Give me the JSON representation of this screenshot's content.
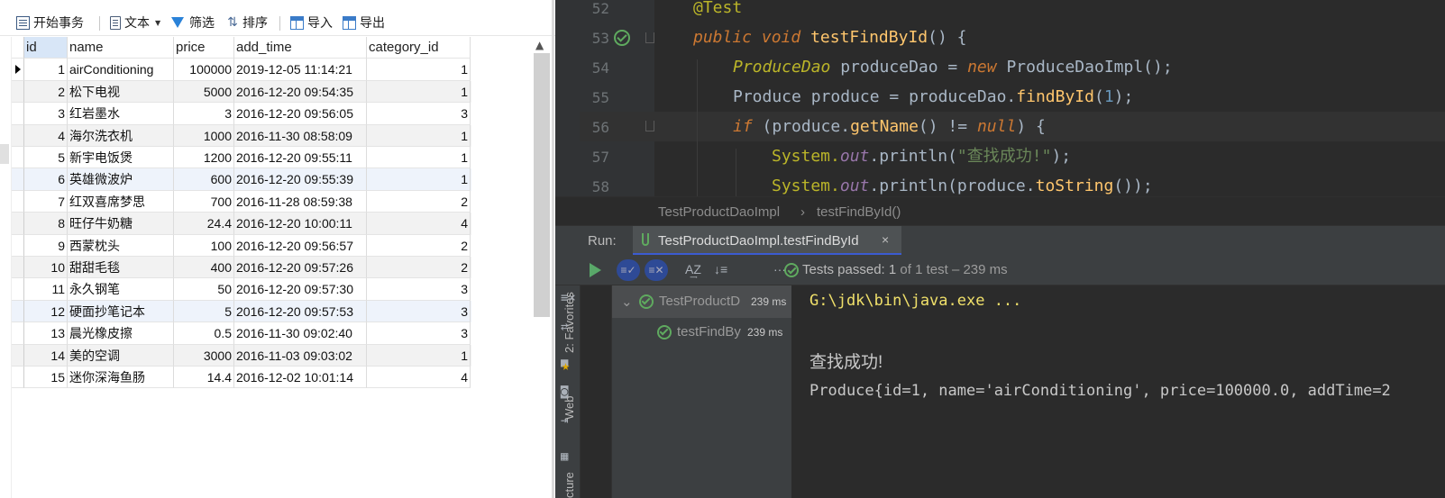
{
  "toolbar": {
    "begin_tx": "开始事务",
    "text": "文本",
    "filter": "筛选",
    "sort": "排序",
    "import": "导入",
    "export": "导出"
  },
  "table": {
    "columns": [
      "id",
      "name",
      "price",
      "add_time",
      "category_id"
    ],
    "rows": [
      [
        "1",
        "airConditioning",
        "100000",
        "2019-12-05 11:14:21",
        "1"
      ],
      [
        "2",
        "松下电视",
        "5000",
        "2016-12-20 09:54:35",
        "1"
      ],
      [
        "3",
        "红岩墨水",
        "3",
        "2016-12-20 09:56:05",
        "3"
      ],
      [
        "4",
        "海尔洗衣机",
        "1000",
        "2016-11-30 08:58:09",
        "1"
      ],
      [
        "5",
        "新宇电饭煲",
        "1200",
        "2016-12-20 09:55:11",
        "1"
      ],
      [
        "6",
        "英雄微波炉",
        "600",
        "2016-12-20 09:55:39",
        "1"
      ],
      [
        "7",
        "红双喜席梦思",
        "700",
        "2016-11-28 08:59:38",
        "2"
      ],
      [
        "8",
        "旺仔牛奶糖",
        "24.4",
        "2016-12-20 10:00:11",
        "4"
      ],
      [
        "9",
        "西蒙枕头",
        "100",
        "2016-12-20 09:56:57",
        "2"
      ],
      [
        "10",
        "甜甜毛毯",
        "400",
        "2016-12-20 09:57:26",
        "2"
      ],
      [
        "11",
        "永久钢笔",
        "50",
        "2016-12-20 09:57:30",
        "3"
      ],
      [
        "12",
        "硬面抄笔记本",
        "5",
        "2016-12-20 09:57:53",
        "3"
      ],
      [
        "13",
        "晨光橡皮擦",
        "0.5",
        "2016-11-30 09:02:40",
        "3"
      ],
      [
        "14",
        "美的空调",
        "3000",
        "2016-11-03 09:03:02",
        "1"
      ],
      [
        "15",
        "迷你深海鱼肠",
        "14.4",
        "2016-12-02 10:01:14",
        "4"
      ]
    ]
  },
  "editor": {
    "line_numbers": [
      "52",
      "53",
      "54",
      "55",
      "56",
      "57",
      "58"
    ],
    "code": {
      "l52": "@Test",
      "l53_k1": "public",
      "l53_k2": "void",
      "l53_fn": "testFindById",
      "l53_rest": "() {",
      "l54_ty": "ProduceDao",
      "l54_mid": " produceDao = ",
      "l54_new": "new",
      "l54_rest": " ProduceDaoImpl();",
      "l55_a": "Produce produce = produceDao.",
      "l55_fn": "findById",
      "l55_b": "(",
      "l55_num": "1",
      "l55_c": ");",
      "l56_if": "if",
      "l56_a": " (produce.",
      "l56_fn": "getName",
      "l56_b": "() != ",
      "l56_null": "null",
      "l56_c": ") {",
      "l57_a": "System.",
      "l57_out": "out",
      "l57_b": ".println(",
      "l57_str": "\"查找成功!\"",
      "l57_c": ");",
      "l58_a": "System.",
      "l58_out": "out",
      "l58_b": ".println(produce.",
      "l58_fn": "toString",
      "l58_c": "());"
    }
  },
  "breadcrumb": [
    "TestProductDaoImpl",
    "›",
    "testFindById()"
  ],
  "run": {
    "label": "Run:",
    "tab": "TestProductDaoImpl.testFindById",
    "close": "×",
    "passed_prefix": "Tests passed:",
    "passed_count": "1",
    "passed_suffix": "of 1 test – 239 ms"
  },
  "tree": {
    "root": "TestProductD",
    "root_ms": "239 ms",
    "child": "testFindBy",
    "child_ms": "239 ms"
  },
  "console": {
    "line1": "G:\\jdk\\bin\\java.exe ...",
    "line2": "查找成功!",
    "line3": "Produce{id=1, name='airConditioning', price=100000.0, addTime=2"
  },
  "sidebar": {
    "favorites": "2: Favorites",
    "web": "Web",
    "structure": "cture"
  },
  "colors": {
    "ide_bg": "#2b2b2b",
    "panel_bg": "#3c3f41",
    "pass_green": "#5faa5f",
    "tab_underline": "#3b5bd1"
  }
}
